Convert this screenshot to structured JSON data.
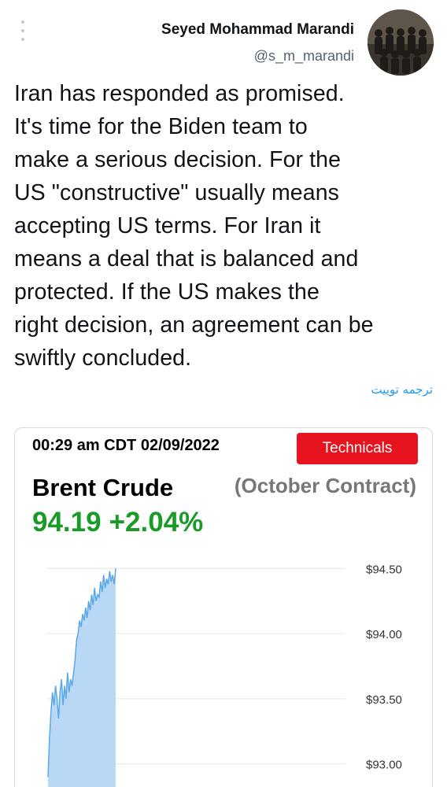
{
  "tweet": {
    "author_name": "Seyed Mohammad Marandi",
    "author_handle": "@s_m_marandi",
    "lines": [
      "Iran has responded as promised.",
      "It's time for the Biden team to",
      "make a serious decision. For the",
      "US \"constructive\" usually means",
      "accepting US terms. For Iran it",
      "means a deal that is balanced and",
      "protected. If the US makes the",
      "right decision, an agreement can be",
      "swiftly concluded."
    ],
    "translate_label": "ترجمه توییت"
  },
  "card": {
    "timestamp": "00:29 am CDT 02/09/2022",
    "technicals_label": "Technicals",
    "commodity": "Brent Crude",
    "contract": "(October Contract)",
    "price": "94.19",
    "change": "+2.04%",
    "colors": {
      "up": "#1a9a27",
      "button": "#e7131f",
      "fill": "#b9d8f5",
      "line": "#5aa8e8"
    }
  },
  "chart_data": {
    "type": "area",
    "y_tick_labels": [
      "$94.50",
      "$94.00",
      "$93.50",
      "$93.00"
    ],
    "y_ticks": [
      94.5,
      94.0,
      93.5,
      93.0
    ],
    "ylim": [
      92.95,
      94.55
    ],
    "series": [
      {
        "values": [
          92.9,
          93.2,
          93.4,
          93.55,
          93.45,
          93.6,
          93.5,
          93.35,
          93.55,
          93.65,
          93.45,
          93.6,
          93.5,
          93.7,
          93.55,
          93.65,
          93.6,
          93.7,
          93.8,
          93.95,
          94.0,
          94.1,
          94.05,
          94.15,
          94.1,
          94.2,
          94.12,
          94.25,
          94.18,
          94.3,
          94.22,
          94.35,
          94.25,
          94.3,
          94.28,
          94.4,
          94.32,
          94.45,
          94.35,
          94.42,
          94.38,
          94.48,
          94.4,
          94.45,
          94.38,
          94.5
        ]
      }
    ]
  }
}
